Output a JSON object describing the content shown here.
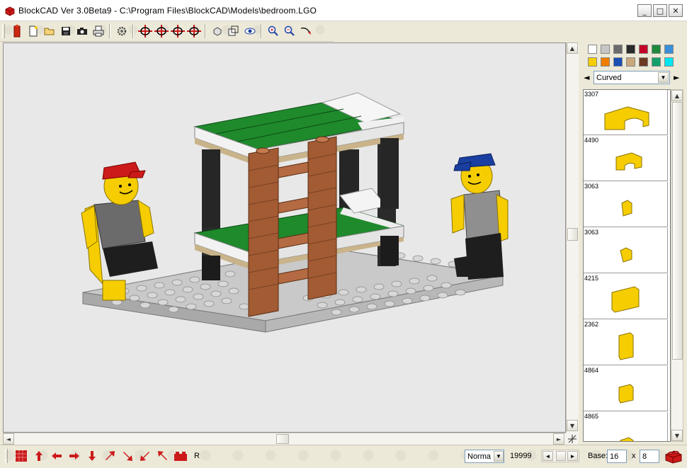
{
  "window": {
    "title": "BlockCAD Ver 3.0Beta9 - C:\\Program Files\\BlockCAD\\Models\\bedroom.LGO",
    "minimize": "_",
    "maximize": "□",
    "close": "✕"
  },
  "main_toolbar": {
    "buttons": [
      "brick-icon",
      "new-icon",
      "open-icon",
      "save-icon",
      "camera-icon",
      "print-icon",
      "settings-icon",
      "rotate-left-icon",
      "rotate-up-icon",
      "rotate-down-icon",
      "rotate-right-icon",
      "view-single-icon",
      "view-multi-icon",
      "eye-icon",
      "zoom-in-icon",
      "zoom-out-icon",
      "rotate-free-icon"
    ]
  },
  "side_toolbar": {
    "buttons": [
      "pointer-icon",
      "eye-icon",
      "brick-view-icon",
      "color-rainbow-icon",
      "help-icon"
    ]
  },
  "palette": {
    "colors": [
      "#ffffff",
      "#c6c6c6",
      "#6b6b6b",
      "#2a2a2a",
      "#c40026",
      "#1e8a3c",
      "#3a8fd8",
      "#f5cd00",
      "#f07d00",
      "#1a4fb4",
      "#c9a77a",
      "#6b3a22",
      "#15a06a",
      "#00e5f0"
    ]
  },
  "category": {
    "selected": "Curved",
    "prev": "◄",
    "next": "►"
  },
  "parts": [
    {
      "id": "3307"
    },
    {
      "id": "4490"
    },
    {
      "id": "3063"
    },
    {
      "id": "3063"
    },
    {
      "id": "4215"
    },
    {
      "id": "2362"
    },
    {
      "id": "4864"
    },
    {
      "id": "4865"
    }
  ],
  "bottom": {
    "mode": "Norma",
    "count": "19999",
    "base_label": "Base:",
    "base_x": "16",
    "x_label": "x",
    "base_y": "8",
    "r_label": "R"
  },
  "colors": {
    "canvas_bg": "#e8e8e8",
    "toolbar_bg": "#ece9d8",
    "accent_red": "#cc1a1a"
  }
}
